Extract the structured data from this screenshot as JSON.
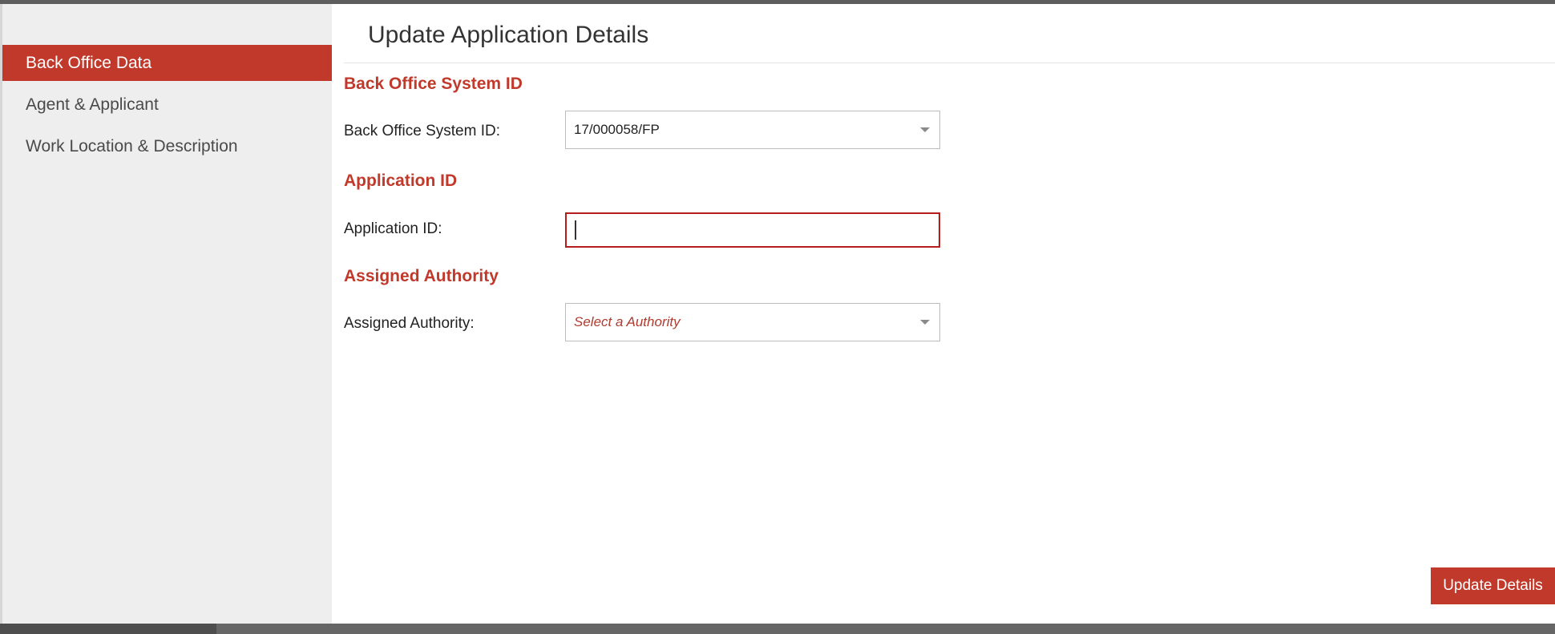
{
  "sidebar": {
    "items": [
      {
        "label": "Back Office Data",
        "active": true
      },
      {
        "label": "Agent & Applicant",
        "active": false
      },
      {
        "label": "Work Location & Description",
        "active": false
      }
    ]
  },
  "main": {
    "title": "Update Application Details",
    "sections": {
      "back_office": {
        "heading": "Back Office System ID",
        "label": "Back Office System ID:",
        "value": "17/000058/FP"
      },
      "application_id": {
        "heading": "Application ID",
        "label": "Application ID:",
        "value": ""
      },
      "assigned_authority": {
        "heading": "Assigned Authority",
        "label": "Assigned Authority:",
        "placeholder": "Select a Authority"
      }
    },
    "submit_label": "Update Details"
  },
  "colors": {
    "accent": "#c0392b",
    "sidebar_bg": "#eeeeee",
    "invalid_border": "#b81d1d"
  },
  "icons": {
    "dropdown": "caret-down-icon"
  }
}
